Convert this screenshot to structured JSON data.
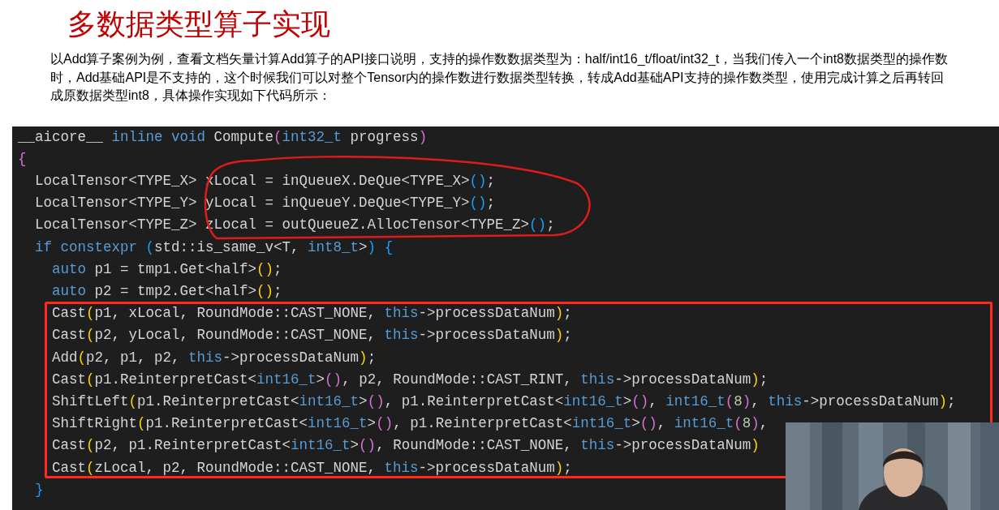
{
  "title": "多数据类型算子实现",
  "description": "以Add算子案例为例，查看文档矢量计算Add算子的API接口说明，支持的操作数数据类型为：half/int16_t/float/int32_t，当我们传入一个int8数据类型的操作数时，Add基础API是不支持的，这个时候我们可以对整个Tensor内的操作数进行数据类型转换，转成Add基础API支持的操作数类型，使用完成计算之后再转回成原数据类型int8，具体操作实现如下代码所示：",
  "code_lines": [
    [
      {
        "text": "__aicore__ ",
        "kind": "plain"
      },
      {
        "text": "inline void",
        "kind": "keyword"
      },
      {
        "text": " Compute",
        "kind": "plain"
      },
      {
        "text": "(",
        "kind": "bracket2"
      },
      {
        "text": "int32_t",
        "kind": "keyword"
      },
      {
        "text": " progress",
        "kind": "plain"
      },
      {
        "text": ")",
        "kind": "bracket2"
      }
    ],
    [
      {
        "text": "{",
        "kind": "bracket2"
      }
    ],
    [
      {
        "text": "  LocalTensor<TYPE_X> xLocal = inQueueX.DeQue<TYPE_X>",
        "kind": "plain"
      },
      {
        "text": "()",
        "kind": "bracket3"
      },
      {
        "text": ";",
        "kind": "plain"
      }
    ],
    [
      {
        "text": "  LocalTensor<TYPE_Y> yLocal = inQueueY.DeQue<TYPE_Y>",
        "kind": "plain"
      },
      {
        "text": "()",
        "kind": "bracket3"
      },
      {
        "text": ";",
        "kind": "plain"
      }
    ],
    [
      {
        "text": "  LocalTensor<TYPE_Z> zLocal = outQueueZ.AllocTensor<TYPE_Z>",
        "kind": "plain"
      },
      {
        "text": "()",
        "kind": "bracket3"
      },
      {
        "text": ";",
        "kind": "plain"
      }
    ],
    [
      {
        "text": "  if constexpr ",
        "kind": "keyword"
      },
      {
        "text": "(",
        "kind": "bracket3"
      },
      {
        "text": "std::is_same_v<T, ",
        "kind": "plain"
      },
      {
        "text": "int8_t",
        "kind": "keyword"
      },
      {
        "text": ">",
        "kind": "plain"
      },
      {
        "text": ")",
        "kind": "bracket3"
      },
      {
        "text": " {",
        "kind": "bracket3"
      }
    ],
    [
      {
        "text": "    auto",
        "kind": "keyword"
      },
      {
        "text": " p1 = tmp1.Get<half>",
        "kind": "plain"
      },
      {
        "text": "()",
        "kind": "bracket1"
      },
      {
        "text": ";",
        "kind": "plain"
      }
    ],
    [
      {
        "text": "    auto",
        "kind": "keyword"
      },
      {
        "text": " p2 = tmp2.Get<half>",
        "kind": "plain"
      },
      {
        "text": "()",
        "kind": "bracket1"
      },
      {
        "text": ";",
        "kind": "plain"
      }
    ],
    [
      {
        "text": "    Cast",
        "kind": "plain"
      },
      {
        "text": "(",
        "kind": "bracket1"
      },
      {
        "text": "p1, xLocal, RoundMode::CAST_NONE, ",
        "kind": "plain"
      },
      {
        "text": "this",
        "kind": "keyword"
      },
      {
        "text": "->processDataNum",
        "kind": "plain"
      },
      {
        "text": ")",
        "kind": "bracket1"
      },
      {
        "text": ";",
        "kind": "plain"
      }
    ],
    [
      {
        "text": "    Cast",
        "kind": "plain"
      },
      {
        "text": "(",
        "kind": "bracket1"
      },
      {
        "text": "p2, yLocal, RoundMode::CAST_NONE, ",
        "kind": "plain"
      },
      {
        "text": "this",
        "kind": "keyword"
      },
      {
        "text": "->processDataNum",
        "kind": "plain"
      },
      {
        "text": ")",
        "kind": "bracket1"
      },
      {
        "text": ";",
        "kind": "plain"
      }
    ],
    [
      {
        "text": "    Add",
        "kind": "plain"
      },
      {
        "text": "(",
        "kind": "bracket1"
      },
      {
        "text": "p2, p1, p2, ",
        "kind": "plain"
      },
      {
        "text": "this",
        "kind": "keyword"
      },
      {
        "text": "->processDataNum",
        "kind": "plain"
      },
      {
        "text": ")",
        "kind": "bracket1"
      },
      {
        "text": ";",
        "kind": "plain"
      }
    ],
    [
      {
        "text": "    Cast",
        "kind": "plain"
      },
      {
        "text": "(",
        "kind": "bracket1"
      },
      {
        "text": "p1.ReinterpretCast<",
        "kind": "plain"
      },
      {
        "text": "int16_t",
        "kind": "keyword"
      },
      {
        "text": ">",
        "kind": "plain"
      },
      {
        "text": "()",
        "kind": "bracket2"
      },
      {
        "text": ", p2, RoundMode::CAST_RINT, ",
        "kind": "plain"
      },
      {
        "text": "this",
        "kind": "keyword"
      },
      {
        "text": "->processDataNum",
        "kind": "plain"
      },
      {
        "text": ")",
        "kind": "bracket1"
      },
      {
        "text": ";",
        "kind": "plain"
      }
    ],
    [
      {
        "text": "    ShiftLeft",
        "kind": "plain"
      },
      {
        "text": "(",
        "kind": "bracket1"
      },
      {
        "text": "p1.ReinterpretCast<",
        "kind": "plain"
      },
      {
        "text": "int16_t",
        "kind": "keyword"
      },
      {
        "text": ">",
        "kind": "plain"
      },
      {
        "text": "()",
        "kind": "bracket2"
      },
      {
        "text": ", p1.ReinterpretCast<",
        "kind": "plain"
      },
      {
        "text": "int16_t",
        "kind": "keyword"
      },
      {
        "text": ">",
        "kind": "plain"
      },
      {
        "text": "()",
        "kind": "bracket2"
      },
      {
        "text": ", ",
        "kind": "plain"
      },
      {
        "text": "int16_t",
        "kind": "keyword"
      },
      {
        "text": "(",
        "kind": "bracket2"
      },
      {
        "text": "8",
        "kind": "number"
      },
      {
        "text": ")",
        "kind": "bracket2"
      },
      {
        "text": ", ",
        "kind": "plain"
      },
      {
        "text": "this",
        "kind": "keyword"
      },
      {
        "text": "->processDataNum",
        "kind": "plain"
      },
      {
        "text": ")",
        "kind": "bracket1"
      },
      {
        "text": ";",
        "kind": "plain"
      }
    ],
    [
      {
        "text": "    ShiftRight",
        "kind": "plain"
      },
      {
        "text": "(",
        "kind": "bracket1"
      },
      {
        "text": "p1.ReinterpretCast<",
        "kind": "plain"
      },
      {
        "text": "int16_t",
        "kind": "keyword"
      },
      {
        "text": ">",
        "kind": "plain"
      },
      {
        "text": "()",
        "kind": "bracket2"
      },
      {
        "text": ", p1.ReinterpretCast<",
        "kind": "plain"
      },
      {
        "text": "int16_t",
        "kind": "keyword"
      },
      {
        "text": ">",
        "kind": "plain"
      },
      {
        "text": "()",
        "kind": "bracket2"
      },
      {
        "text": ", ",
        "kind": "plain"
      },
      {
        "text": "int16_t",
        "kind": "keyword"
      },
      {
        "text": "(",
        "kind": "bracket2"
      },
      {
        "text": "8",
        "kind": "number"
      },
      {
        "text": ")",
        "kind": "bracket2"
      },
      {
        "text": ",",
        "kind": "plain"
      }
    ],
    [
      {
        "text": "    Cast",
        "kind": "plain"
      },
      {
        "text": "(",
        "kind": "bracket1"
      },
      {
        "text": "p2, p1.ReinterpretCast<",
        "kind": "plain"
      },
      {
        "text": "int16_t",
        "kind": "keyword"
      },
      {
        "text": ">",
        "kind": "plain"
      },
      {
        "text": "()",
        "kind": "bracket2"
      },
      {
        "text": ", RoundMode::CAST_NONE, ",
        "kind": "plain"
      },
      {
        "text": "this",
        "kind": "keyword"
      },
      {
        "text": "->processDataNum",
        "kind": "plain"
      },
      {
        "text": ")",
        "kind": "bracket1"
      }
    ],
    [
      {
        "text": "    Cast",
        "kind": "plain"
      },
      {
        "text": "(",
        "kind": "bracket1"
      },
      {
        "text": "zLocal, p2, RoundMode::CAST_NONE, ",
        "kind": "plain"
      },
      {
        "text": "this",
        "kind": "keyword"
      },
      {
        "text": "->processDataNum",
        "kind": "plain"
      },
      {
        "text": ")",
        "kind": "bracket1"
      },
      {
        "text": ";",
        "kind": "plain"
      }
    ],
    [
      {
        "text": "  }",
        "kind": "bracket3"
      }
    ]
  ],
  "webcam": {
    "kind": "picture"
  }
}
